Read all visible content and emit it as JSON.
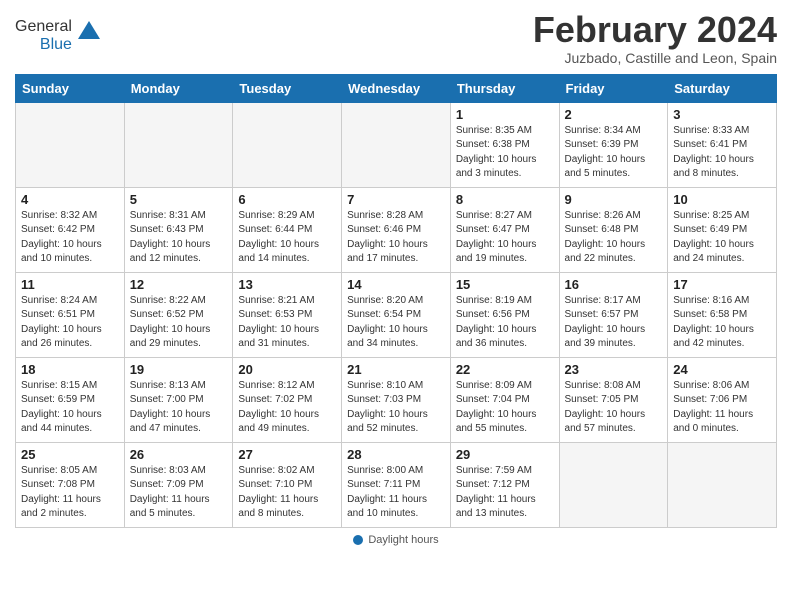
{
  "header": {
    "logo_general": "General",
    "logo_blue": "Blue",
    "month_title": "February 2024",
    "location": "Juzbado, Castille and Leon, Spain"
  },
  "weekdays": [
    "Sunday",
    "Monday",
    "Tuesday",
    "Wednesday",
    "Thursday",
    "Friday",
    "Saturday"
  ],
  "days": [
    {
      "date": "",
      "number": "",
      "info": ""
    },
    {
      "date": "",
      "number": "",
      "info": ""
    },
    {
      "date": "",
      "number": "",
      "info": ""
    },
    {
      "date": "",
      "number": "",
      "info": ""
    },
    {
      "date": "1",
      "number": "1",
      "info": "Sunrise: 8:35 AM\nSunset: 6:38 PM\nDaylight: 10 hours\nand 3 minutes."
    },
    {
      "date": "2",
      "number": "2",
      "info": "Sunrise: 8:34 AM\nSunset: 6:39 PM\nDaylight: 10 hours\nand 5 minutes."
    },
    {
      "date": "3",
      "number": "3",
      "info": "Sunrise: 8:33 AM\nSunset: 6:41 PM\nDaylight: 10 hours\nand 8 minutes."
    },
    {
      "date": "4",
      "number": "4",
      "info": "Sunrise: 8:32 AM\nSunset: 6:42 PM\nDaylight: 10 hours\nand 10 minutes."
    },
    {
      "date": "5",
      "number": "5",
      "info": "Sunrise: 8:31 AM\nSunset: 6:43 PM\nDaylight: 10 hours\nand 12 minutes."
    },
    {
      "date": "6",
      "number": "6",
      "info": "Sunrise: 8:29 AM\nSunset: 6:44 PM\nDaylight: 10 hours\nand 14 minutes."
    },
    {
      "date": "7",
      "number": "7",
      "info": "Sunrise: 8:28 AM\nSunset: 6:46 PM\nDaylight: 10 hours\nand 17 minutes."
    },
    {
      "date": "8",
      "number": "8",
      "info": "Sunrise: 8:27 AM\nSunset: 6:47 PM\nDaylight: 10 hours\nand 19 minutes."
    },
    {
      "date": "9",
      "number": "9",
      "info": "Sunrise: 8:26 AM\nSunset: 6:48 PM\nDaylight: 10 hours\nand 22 minutes."
    },
    {
      "date": "10",
      "number": "10",
      "info": "Sunrise: 8:25 AM\nSunset: 6:49 PM\nDaylight: 10 hours\nand 24 minutes."
    },
    {
      "date": "11",
      "number": "11",
      "info": "Sunrise: 8:24 AM\nSunset: 6:51 PM\nDaylight: 10 hours\nand 26 minutes."
    },
    {
      "date": "12",
      "number": "12",
      "info": "Sunrise: 8:22 AM\nSunset: 6:52 PM\nDaylight: 10 hours\nand 29 minutes."
    },
    {
      "date": "13",
      "number": "13",
      "info": "Sunrise: 8:21 AM\nSunset: 6:53 PM\nDaylight: 10 hours\nand 31 minutes."
    },
    {
      "date": "14",
      "number": "14",
      "info": "Sunrise: 8:20 AM\nSunset: 6:54 PM\nDaylight: 10 hours\nand 34 minutes."
    },
    {
      "date": "15",
      "number": "15",
      "info": "Sunrise: 8:19 AM\nSunset: 6:56 PM\nDaylight: 10 hours\nand 36 minutes."
    },
    {
      "date": "16",
      "number": "16",
      "info": "Sunrise: 8:17 AM\nSunset: 6:57 PM\nDaylight: 10 hours\nand 39 minutes."
    },
    {
      "date": "17",
      "number": "17",
      "info": "Sunrise: 8:16 AM\nSunset: 6:58 PM\nDaylight: 10 hours\nand 42 minutes."
    },
    {
      "date": "18",
      "number": "18",
      "info": "Sunrise: 8:15 AM\nSunset: 6:59 PM\nDaylight: 10 hours\nand 44 minutes."
    },
    {
      "date": "19",
      "number": "19",
      "info": "Sunrise: 8:13 AM\nSunset: 7:00 PM\nDaylight: 10 hours\nand 47 minutes."
    },
    {
      "date": "20",
      "number": "20",
      "info": "Sunrise: 8:12 AM\nSunset: 7:02 PM\nDaylight: 10 hours\nand 49 minutes."
    },
    {
      "date": "21",
      "number": "21",
      "info": "Sunrise: 8:10 AM\nSunset: 7:03 PM\nDaylight: 10 hours\nand 52 minutes."
    },
    {
      "date": "22",
      "number": "22",
      "info": "Sunrise: 8:09 AM\nSunset: 7:04 PM\nDaylight: 10 hours\nand 55 minutes."
    },
    {
      "date": "23",
      "number": "23",
      "info": "Sunrise: 8:08 AM\nSunset: 7:05 PM\nDaylight: 10 hours\nand 57 minutes."
    },
    {
      "date": "24",
      "number": "24",
      "info": "Sunrise: 8:06 AM\nSunset: 7:06 PM\nDaylight: 11 hours\nand 0 minutes."
    },
    {
      "date": "25",
      "number": "25",
      "info": "Sunrise: 8:05 AM\nSunset: 7:08 PM\nDaylight: 11 hours\nand 2 minutes."
    },
    {
      "date": "26",
      "number": "26",
      "info": "Sunrise: 8:03 AM\nSunset: 7:09 PM\nDaylight: 11 hours\nand 5 minutes."
    },
    {
      "date": "27",
      "number": "27",
      "info": "Sunrise: 8:02 AM\nSunset: 7:10 PM\nDaylight: 11 hours\nand 8 minutes."
    },
    {
      "date": "28",
      "number": "28",
      "info": "Sunrise: 8:00 AM\nSunset: 7:11 PM\nDaylight: 11 hours\nand 10 minutes."
    },
    {
      "date": "29",
      "number": "29",
      "info": "Sunrise: 7:59 AM\nSunset: 7:12 PM\nDaylight: 11 hours\nand 13 minutes."
    },
    {
      "date": "",
      "number": "",
      "info": ""
    },
    {
      "date": "",
      "number": "",
      "info": ""
    }
  ],
  "footer": {
    "daylight_label": "Daylight hours"
  }
}
